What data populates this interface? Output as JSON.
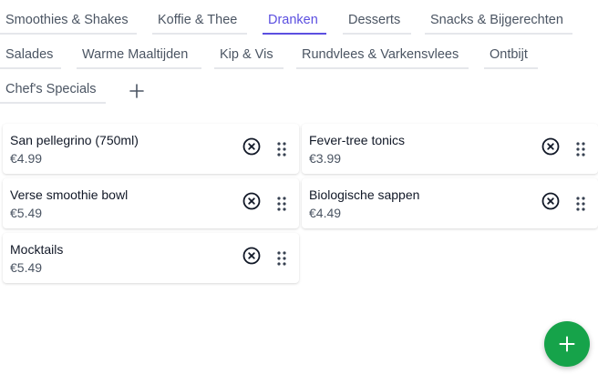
{
  "tabs": [
    {
      "label": "Smoothies & Shakes",
      "active": false
    },
    {
      "label": "Koffie & Thee",
      "active": false
    },
    {
      "label": "Dranken",
      "active": true
    },
    {
      "label": "Desserts",
      "active": false
    },
    {
      "label": "Snacks & Bijgerechten",
      "active": false
    },
    {
      "label": "Salades",
      "active": false
    },
    {
      "label": "Warme Maaltijden",
      "active": false
    },
    {
      "label": "Kip & Vis",
      "active": false
    },
    {
      "label": "Rundvlees & Varkensvlees",
      "active": false
    },
    {
      "label": "Ontbijt",
      "active": false
    },
    {
      "label": "Chef's Specials",
      "active": false
    }
  ],
  "add_tab_icon": "plus-icon",
  "items": [
    {
      "name": "San pellegrino (750ml)",
      "price": "€4.99"
    },
    {
      "name": "Fever-tree tonics",
      "price": "€3.99"
    },
    {
      "name": "Verse smoothie bowl",
      "price": "€5.49"
    },
    {
      "name": "Biologische sappen",
      "price": "€4.49"
    },
    {
      "name": "Mocktails",
      "price": "€5.49"
    }
  ],
  "item_icons": {
    "remove": "x-circle-icon",
    "drag": "drag-handle-icon"
  },
  "fab_icon": "plus-icon",
  "colors": {
    "accent": "#5b4fe0",
    "fab": "#16a34a",
    "tab_text": "#4b5563",
    "tab_border": "#e5e7eb"
  }
}
